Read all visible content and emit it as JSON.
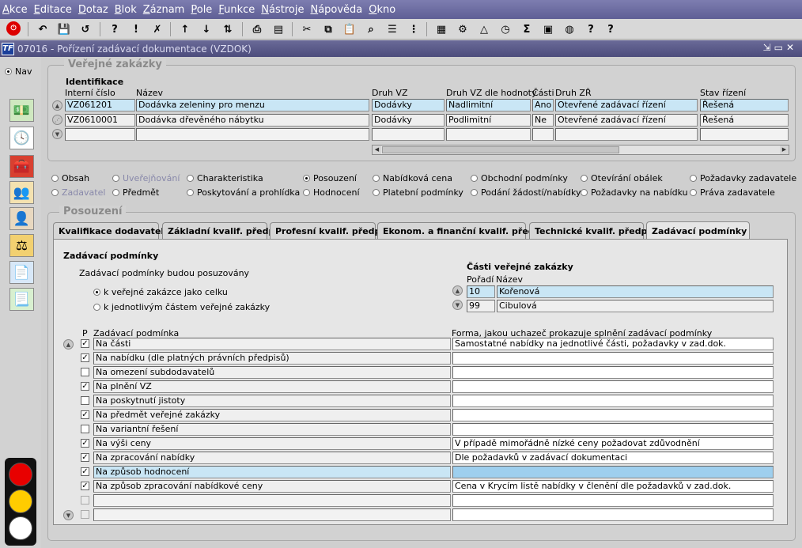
{
  "menu": [
    "Akce",
    "Editace",
    "Dotaz",
    "Blok",
    "Záznam",
    "Pole",
    "Funkce",
    "Nástroje",
    "Nápověda",
    "Okno"
  ],
  "toolbar_icons": [
    "exit-icon",
    "back-icon",
    "save-icon",
    "undo-icon",
    "enter-query-icon",
    "execute-query-icon",
    "cancel-query-icon",
    "sort-asc-icon",
    "sort-desc-icon",
    "sort-multi-icon",
    "print-icon",
    "print-preview-icon",
    "cut-icon",
    "copy-icon",
    "paste-icon",
    "find-icon",
    "list-icon",
    "tree-icon",
    "calculator-icon",
    "filter-icon",
    "triangle-icon",
    "clock-icon",
    "sum-icon",
    "excel-icon",
    "globe-icon",
    "help-topics-icon",
    "help-icon"
  ],
  "window": {
    "title": "07016 - Pořízení zadávací dokumentace (VZDOK)",
    "logo": "TF"
  },
  "nav": {
    "label": "Nav"
  },
  "sidebar_icons": [
    "money-icon",
    "clock-icon",
    "toolbox-icon",
    "people-icon",
    "person-icon",
    "scales-icon",
    "document-icon",
    "new-document-icon"
  ],
  "verejne_zakazky": {
    "title": "Veřejné zakázky",
    "section_label": "Identifikace",
    "columns": [
      "Interní číslo",
      "Název",
      "Druh VZ",
      "Druh VZ dle hodnoty",
      "Části",
      "Druh ZŘ",
      "Stav řízení"
    ],
    "rows": [
      [
        "VZ061201",
        "Dodávka zeleniny pro menzu",
        "Dodávky",
        "Nadlimitní",
        "Ano",
        "Otevřené zadávací řízení",
        "Řešená"
      ],
      [
        "VZ0610001",
        "Dodávka dřevěného nábytku",
        "Dodávky",
        "Podlimitní",
        "Ne",
        "Otevřené zadávací řízení",
        "Řešená"
      ]
    ]
  },
  "sections": [
    {
      "label": "Obsah",
      "selected": false,
      "disabled": false
    },
    {
      "label": "Uveřejňování",
      "selected": false,
      "disabled": true
    },
    {
      "label": "Charakteristika",
      "selected": false,
      "disabled": false
    },
    {
      "label": "Posouzení",
      "selected": true,
      "disabled": false
    },
    {
      "label": "Nabídková cena",
      "selected": false,
      "disabled": false
    },
    {
      "label": "Obchodní podmínky",
      "selected": false,
      "disabled": false
    },
    {
      "label": "Otevírání obálek",
      "selected": false,
      "disabled": false
    },
    {
      "label": "Požadavky zadavatele",
      "selected": false,
      "disabled": false
    },
    {
      "label": "Zadavatel",
      "selected": false,
      "disabled": true
    },
    {
      "label": "Předmět",
      "selected": false,
      "disabled": false
    },
    {
      "label": "Poskytování a prohlídka",
      "selected": false,
      "disabled": false
    },
    {
      "label": "Hodnocení",
      "selected": false,
      "disabled": false
    },
    {
      "label": "Platební podmínky",
      "selected": false,
      "disabled": false
    },
    {
      "label": "Podání žádostí/nabídky",
      "selected": false,
      "disabled": false
    },
    {
      "label": "Požadavky na nabídku",
      "selected": false,
      "disabled": false
    },
    {
      "label": "Práva zadavatele",
      "selected": false,
      "disabled": false
    }
  ],
  "posouzeni": {
    "title": "Posouzení",
    "tabs": [
      "Kvalifikace dodavatelů",
      "Základní kvalif. předp.",
      "Profesní kvalif. předp.",
      "Ekonom. a finanční kvalif. předp.",
      "Technické kvalif. předp.",
      "Zadávací podmínky"
    ],
    "active_tab": "Zadávací podmínky",
    "heading": "Zadávací podmínky",
    "posuzovani_label": "Zadávací podmínky budou posuzovány",
    "options": [
      {
        "label": "k veřejné zakázce jako celku",
        "selected": true
      },
      {
        "label": "k jednotlivým částem veřejné zakázky",
        "selected": false
      }
    ],
    "casti": {
      "title": "Části veřejné zakázky",
      "columns": [
        "Pořadí",
        "Název"
      ],
      "rows": [
        [
          "10",
          "Kořenová"
        ],
        [
          "99",
          "Cibulová"
        ]
      ]
    },
    "conditions_columns": [
      "P",
      "Zadávací podmínka",
      "Forma, jakou uchazeč prokazuje splnění zadávací podmínky"
    ],
    "conditions": [
      {
        "checked": true,
        "name": "Na části",
        "forma": "Samostatné nabídky na jednotlivé části, požadavky v zad.dok."
      },
      {
        "checked": true,
        "name": "Na nabídku (dle platných právních předpisů)",
        "forma": ""
      },
      {
        "checked": false,
        "name": "Na omezení subdodavatelů",
        "forma": ""
      },
      {
        "checked": true,
        "name": "Na plnění VZ",
        "forma": ""
      },
      {
        "checked": false,
        "name": "Na poskytnutí jistoty",
        "forma": ""
      },
      {
        "checked": true,
        "name": "Na předmět veřejné zakázky",
        "forma": ""
      },
      {
        "checked": false,
        "name": "Na variantní řešení",
        "forma": ""
      },
      {
        "checked": true,
        "name": "Na výši ceny",
        "forma": "V případě mimořádně nízké ceny požadovat zdůvodnění"
      },
      {
        "checked": true,
        "name": "Na zpracování nabídky",
        "forma": "Dle požadavků v zadávací dokumentaci"
      },
      {
        "checked": true,
        "name": "Na způsob hodnocení",
        "forma": "",
        "selected": true
      },
      {
        "checked": true,
        "name": "Na způsob zpracování nabídkové ceny",
        "forma": "Cena v Krycím listě nabídky v členění dle požadavků v zad.dok."
      },
      {
        "checked": false,
        "name": "",
        "forma": ""
      },
      {
        "checked": false,
        "name": "",
        "forma": ""
      }
    ]
  },
  "colors": {
    "selected_row": "#c9e6f5",
    "title_blue": "#5f5f95",
    "traffic_red": "#e80000",
    "traffic_yellow": "#ffcc00",
    "traffic_white": "#ffffff"
  }
}
